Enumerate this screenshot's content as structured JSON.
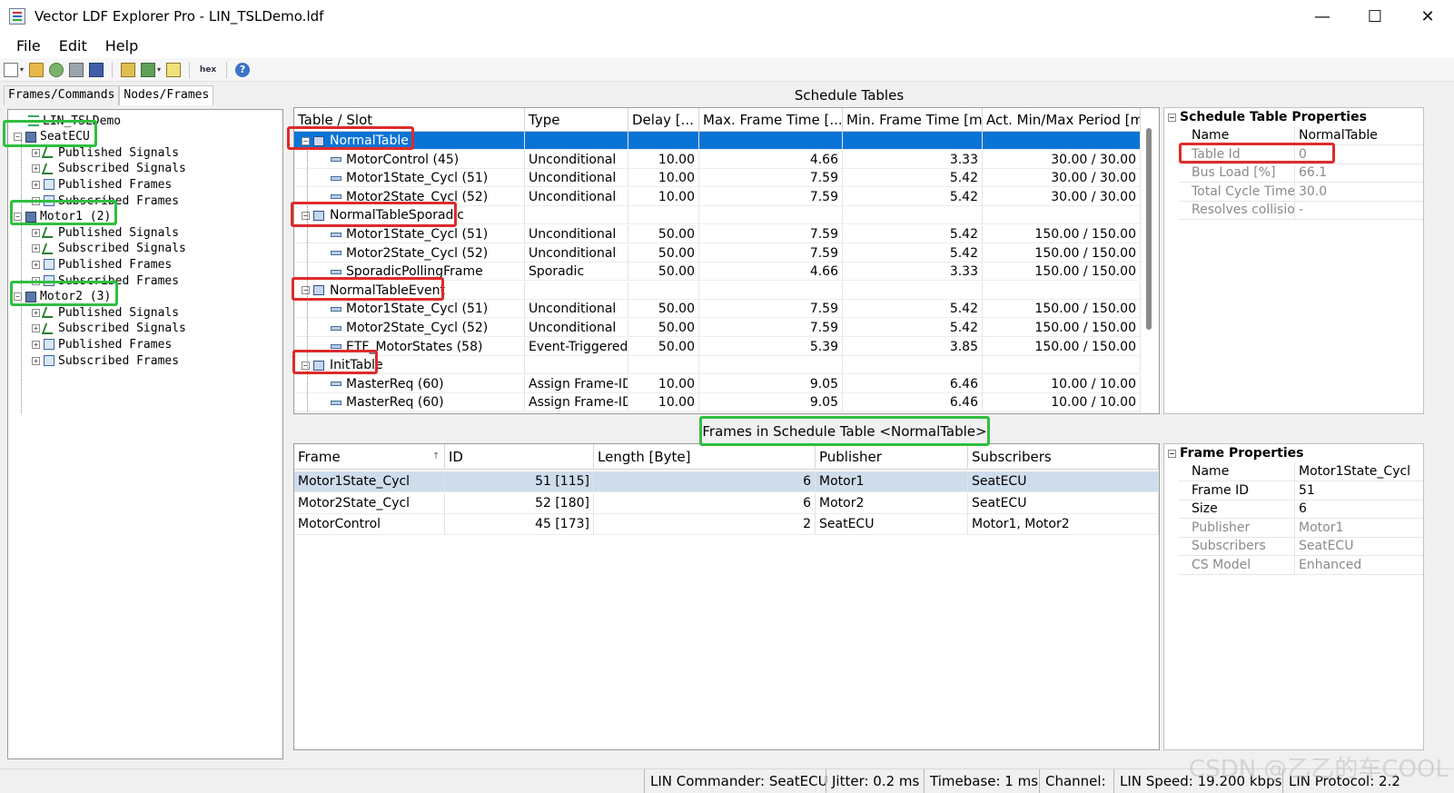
{
  "window": {
    "title": "Vector LDF Explorer Pro - LIN_TSLDemo.ldf",
    "minimize": "—",
    "maximize": "☐",
    "close": "✕"
  },
  "menu": {
    "items": [
      "File",
      "Edit",
      "Help"
    ]
  },
  "toolbar": {
    "hex_label": "hex",
    "help_label": "?"
  },
  "left_panel": {
    "tabs": [
      "Frames/Commands",
      "Nodes/Frames"
    ],
    "active_tab": "Nodes/Frames",
    "tree": [
      {
        "label": "LIN_TSLDemo",
        "level": 0,
        "icon": "database-icon"
      },
      {
        "label": "SeatECU",
        "level": 1,
        "icon": "ecu-icon",
        "expander": "−"
      },
      {
        "label": "Published Signals",
        "level": 2,
        "icon": "signal-icon",
        "expander": "+"
      },
      {
        "label": "Subscribed Signals",
        "level": 2,
        "icon": "signal-icon",
        "expander": "+"
      },
      {
        "label": "Published Frames",
        "level": 2,
        "icon": "frame-icon",
        "expander": "+"
      },
      {
        "label": "Subscribed Frames",
        "level": 2,
        "icon": "frame-icon",
        "expander": "+"
      },
      {
        "label": "Motor1 (2)",
        "level": 1,
        "icon": "ecu-icon",
        "expander": "−"
      },
      {
        "label": "Published Signals",
        "level": 2,
        "icon": "signal-icon",
        "expander": "+"
      },
      {
        "label": "Subscribed Signals",
        "level": 2,
        "icon": "signal-icon",
        "expander": "+"
      },
      {
        "label": "Published Frames",
        "level": 2,
        "icon": "frame-icon",
        "expander": "+"
      },
      {
        "label": "Subscribed Frames",
        "level": 2,
        "icon": "frame-icon",
        "expander": "+"
      },
      {
        "label": "Motor2 (3)",
        "level": 1,
        "icon": "ecu-icon",
        "expander": "−"
      },
      {
        "label": "Published Signals",
        "level": 2,
        "icon": "signal-icon",
        "expander": "+"
      },
      {
        "label": "Subscribed Signals",
        "level": 2,
        "icon": "signal-icon",
        "expander": "+"
      },
      {
        "label": "Published Frames",
        "level": 2,
        "icon": "frame-icon",
        "expander": "+"
      },
      {
        "label": "Subscribed Frames",
        "level": 2,
        "icon": "frame-icon",
        "expander": "+"
      }
    ]
  },
  "schedule_tables": {
    "title": "Schedule Tables",
    "columns": [
      "Table / Slot",
      "Type",
      "Delay [...",
      "Max. Frame Time [...",
      "Min. Frame Time [ms]",
      "Act. Min/Max Period [ms]"
    ],
    "rows": [
      {
        "kind": "table",
        "name": "NormalTable",
        "selected": true
      },
      {
        "kind": "slot",
        "name": "MotorControl (45)",
        "type": "Unconditional",
        "delay": "10.00",
        "max": "4.66",
        "min": "3.33",
        "period": "30.00 / 30.00"
      },
      {
        "kind": "slot",
        "name": "Motor1State_Cycl (51)",
        "type": "Unconditional",
        "delay": "10.00",
        "max": "7.59",
        "min": "5.42",
        "period": "30.00 / 30.00"
      },
      {
        "kind": "slot",
        "name": "Motor2State_Cycl (52)",
        "type": "Unconditional",
        "delay": "10.00",
        "max": "7.59",
        "min": "5.42",
        "period": "30.00 / 30.00"
      },
      {
        "kind": "table",
        "name": "NormalTableSporadic"
      },
      {
        "kind": "slot",
        "name": "Motor1State_Cycl (51)",
        "type": "Unconditional",
        "delay": "50.00",
        "max": "7.59",
        "min": "5.42",
        "period": "150.00 / 150.00"
      },
      {
        "kind": "slot",
        "name": "Motor2State_Cycl (52)",
        "type": "Unconditional",
        "delay": "50.00",
        "max": "7.59",
        "min": "5.42",
        "period": "150.00 / 150.00"
      },
      {
        "kind": "slot",
        "name": "SporadicPollingFrame",
        "type": "Sporadic",
        "delay": "50.00",
        "max": "4.66",
        "min": "3.33",
        "period": "150.00 / 150.00"
      },
      {
        "kind": "table",
        "name": "NormalTableEvent"
      },
      {
        "kind": "slot",
        "name": "Motor1State_Cycl (51)",
        "type": "Unconditional",
        "delay": "50.00",
        "max": "7.59",
        "min": "5.42",
        "period": "150.00 / 150.00"
      },
      {
        "kind": "slot",
        "name": "Motor2State_Cycl (52)",
        "type": "Unconditional",
        "delay": "50.00",
        "max": "7.59",
        "min": "5.42",
        "period": "150.00 / 150.00"
      },
      {
        "kind": "slot",
        "name": "ETF_MotorStates (58)",
        "type": "Event-Triggered",
        "delay": "50.00",
        "max": "5.39",
        "min": "3.85",
        "period": "150.00 / 150.00"
      },
      {
        "kind": "table",
        "name": "InitTable"
      },
      {
        "kind": "slot",
        "name": "MasterReq (60)",
        "type": "Assign Frame-ID",
        "delay": "10.00",
        "max": "9.05",
        "min": "6.46",
        "period": "10.00 / 10.00"
      },
      {
        "kind": "slot",
        "name": "MasterReq (60)",
        "type": "Assign Frame-ID",
        "delay": "10.00",
        "max": "9.05",
        "min": "6.46",
        "period": "10.00 / 10.00"
      }
    ]
  },
  "schedule_props": {
    "title": "Schedule Table Properties",
    "rows": [
      {
        "key": "Name",
        "value": "NormalTable",
        "dim": false
      },
      {
        "key": "Table Id",
        "value": "0",
        "dim": true
      },
      {
        "key": "Bus Load [%]",
        "value": "66.1",
        "dim": true
      },
      {
        "key": "Total Cycle Time",
        "value": "30.0",
        "dim": true
      },
      {
        "key": "Resolves collisions",
        "value": "-",
        "dim": true
      }
    ]
  },
  "frames_section": {
    "title": "Frames in Schedule Table <NormalTable>",
    "columns": [
      "Frame",
      "ID",
      "Length [Byte]",
      "Publisher",
      "Subscribers"
    ],
    "sort_indicator": "↑",
    "rows": [
      {
        "frame": "Motor1State_Cycl",
        "id": "51 [115]",
        "length": "6",
        "publisher": "Motor1",
        "subscribers": "SeatECU",
        "selected": true
      },
      {
        "frame": "Motor2State_Cycl",
        "id": "52 [180]",
        "length": "6",
        "publisher": "Motor2",
        "subscribers": "SeatECU"
      },
      {
        "frame": "MotorControl",
        "id": "45 [173]",
        "length": "2",
        "publisher": "SeatECU",
        "subscribers": "Motor1, Motor2"
      }
    ]
  },
  "frame_props": {
    "title": "Frame Properties",
    "rows": [
      {
        "key": "Name",
        "value": "Motor1State_Cycl",
        "dim": false
      },
      {
        "key": "Frame ID",
        "value": "51",
        "dim": false
      },
      {
        "key": "Size",
        "value": "6",
        "dim": false
      },
      {
        "key": "Publisher",
        "value": "Motor1",
        "dim": true
      },
      {
        "key": "Subscribers",
        "value": "SeatECU",
        "dim": true
      },
      {
        "key": "CS Model",
        "value": "Enhanced",
        "dim": true
      }
    ]
  },
  "status": {
    "commander": "LIN Commander: SeatECU",
    "jitter": "Jitter: 0.2 ms",
    "timebase": "Timebase: 1 ms",
    "channel": "Channel:",
    "speed": "LIN Speed: 19.200 kbps",
    "protocol": "LIN Protocol: 2.2"
  },
  "watermark": "CSDN @乙乙的车COOL",
  "colors": {
    "selection": "#0a74d6",
    "highlight_red": "#e02a2a",
    "highlight_green": "#2fbf3f"
  }
}
